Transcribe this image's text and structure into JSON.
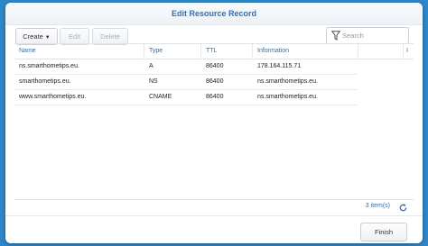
{
  "dialog": {
    "title": "Edit Resource Record"
  },
  "toolbar": {
    "create_label": "Create",
    "edit_label": "Edit",
    "delete_label": "Delete",
    "search_placeholder": "Search"
  },
  "table": {
    "headers": [
      "Name",
      "Type",
      "TTL",
      "Information",
      "",
      "I"
    ],
    "rows": [
      {
        "name": "ns.smarthometips.eu.",
        "type": "A",
        "ttl": "86400",
        "info": "178.164.115.71"
      },
      {
        "name": "smarthometips.eu.",
        "type": "NS",
        "ttl": "86400",
        "info": "ns.smarthometips.eu."
      },
      {
        "name": "www.smarthometips.eu.",
        "type": "CNAME",
        "ttl": "86400",
        "info": "ns.smarthometips.eu."
      }
    ]
  },
  "footer": {
    "count": "3 item(s)",
    "finish_label": "Finish"
  },
  "colors": {
    "accent": "#2e71b6",
    "background": "#2f86c8"
  },
  "icons": [
    "caret-down-icon",
    "filter-icon",
    "refresh-icon"
  ]
}
